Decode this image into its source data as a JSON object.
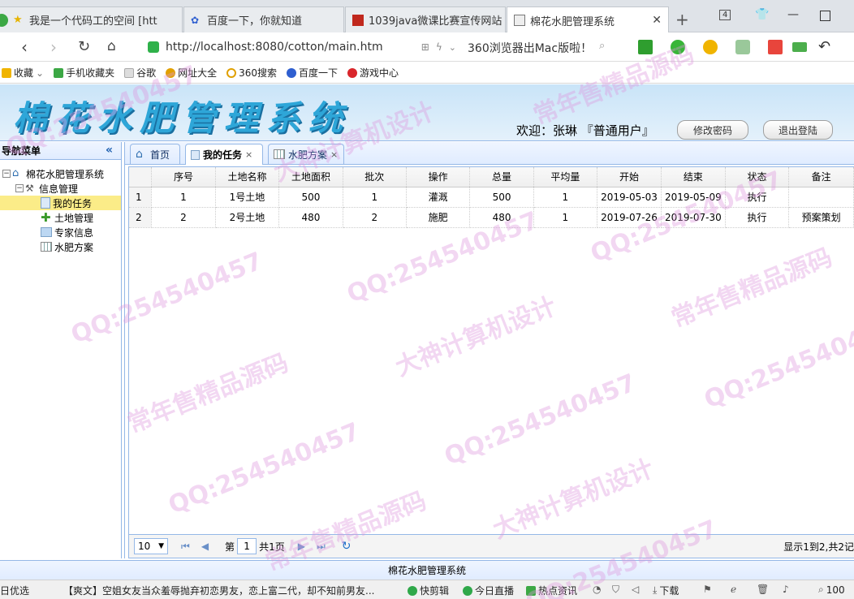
{
  "browser": {
    "tabs": [
      {
        "label": "我是一个代码工的空间 [htt"
      },
      {
        "label": "百度一下，你就知道"
      },
      {
        "label": "1039java微课比赛宣传网站"
      },
      {
        "label": "棉花水肥管理系统"
      }
    ],
    "tab_count": "4",
    "url": "http://localhost:8080/cotton/main.htm",
    "ad_text": "360浏览器出Mac版啦！",
    "bookmarks": [
      "收藏",
      "手机收藏夹",
      "谷歌",
      "网址大全",
      "360搜索",
      "百度一下",
      "游戏中心"
    ]
  },
  "app": {
    "logo": "棉花水肥管理系统",
    "welcome": "欢迎：张琳 『普通用户』",
    "change_password": "修改密码",
    "logout": "退出登陆",
    "footer": "棉花水肥管理系统"
  },
  "leftnav": {
    "title": "导航菜单",
    "root": "棉花水肥管理系统",
    "group": "信息管理",
    "items": [
      "我的任务",
      "土地管理",
      "专家信息",
      "水肥方案"
    ]
  },
  "content_tabs": [
    "首页",
    "我的任务",
    "水肥方案"
  ],
  "grid": {
    "columns": [
      "序号",
      "土地名称",
      "土地面积",
      "批次",
      "操作",
      "总量",
      "平均量",
      "开始",
      "结束",
      "状态",
      "备注"
    ],
    "rows": [
      {
        "rn": "1",
        "cells": [
          "1",
          "1号土地",
          "500",
          "1",
          "灌溉",
          "500",
          "1",
          "2019-05-03",
          "2019-05-09",
          "执行",
          ""
        ]
      },
      {
        "rn": "2",
        "cells": [
          "2",
          "2号土地",
          "480",
          "2",
          "施肥",
          "480",
          "1",
          "2019-07-26",
          "2019-07-30",
          "执行",
          "预案策划"
        ]
      }
    ]
  },
  "pager": {
    "page_size": "10",
    "page_prefix": "第",
    "page": "1",
    "page_suffix": "共1页",
    "info": "显示1到2,共2记"
  },
  "statusbar": {
    "left": "日优选",
    "news": "【爽文】空姐女友当众羞辱抛弃初恋男友，恋上富二代，却不知前男友...",
    "items": [
      "快剪辑",
      "今日直播",
      "热点资讯",
      "下载"
    ],
    "zoom": "100"
  },
  "watermarks": [
    "QQ:254540457",
    "大神计算机设计",
    "常年售精品源码"
  ]
}
